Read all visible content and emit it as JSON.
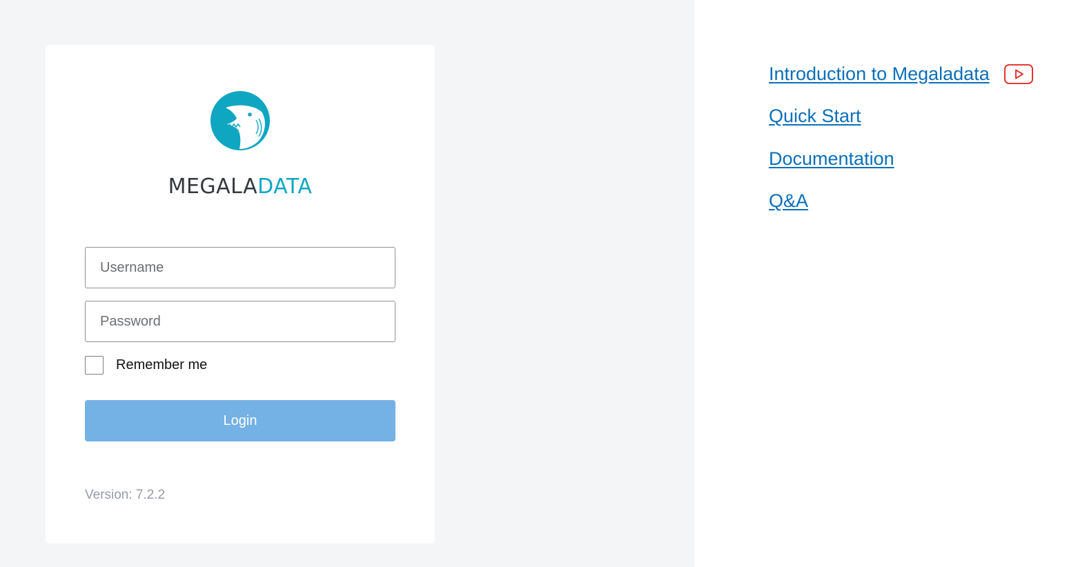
{
  "brand": {
    "name_dark": "MEGALA",
    "name_accent": "DATA",
    "accent_color": "#0fa6c2",
    "dark_color": "#33383f",
    "logo_icon": "shark-logo-icon"
  },
  "login_form": {
    "username_placeholder": "Username",
    "username_value": "",
    "password_placeholder": "Password",
    "password_value": "",
    "remember_label": "Remember me",
    "remember_checked": false,
    "login_label": "Login",
    "login_color": "#74b1e4",
    "version_text": "Version: 7.2.2"
  },
  "help_links": {
    "color": "#0b6fb8",
    "items": [
      {
        "label": "Introduction to Megaladata",
        "icon": "youtube-play-icon"
      },
      {
        "label": "Quick Start"
      },
      {
        "label": "Documentation"
      },
      {
        "label": "Q&A"
      }
    ]
  }
}
